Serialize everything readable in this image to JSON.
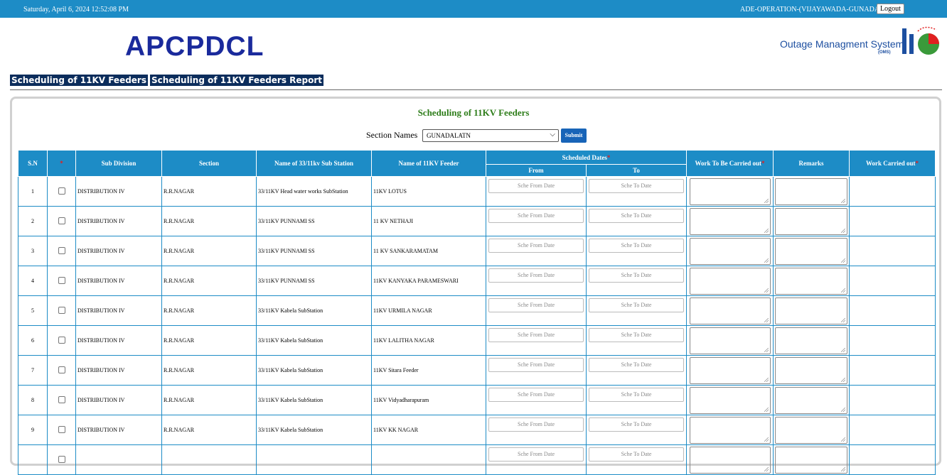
{
  "topbar": {
    "datetime": "Saturday, April 6, 2024 12:52:08 PM",
    "user": "ADE-OPERATION-(VIJAYAWADA-GUNADALA)",
    "logout": "Logout"
  },
  "brand": {
    "name": "APCPDCL",
    "oms_text": "Outage Managment System",
    "oms_sub": "(OMS)"
  },
  "nav": {
    "link1": "Scheduling of 11KV Feeders",
    "link2": "Scheduling of 11KV Feeders Report"
  },
  "page": {
    "title": "Scheduling of 11KV Feeders",
    "section_label": "Section Names",
    "section_value": "GUNADALATN",
    "submit": "Submit"
  },
  "colors": {
    "accent": "#1d8cc6",
    "brand": "#1a2a9c",
    "nav_bg": "#0c2d5c",
    "title_green": "#2e7d1a",
    "required": "#e02020"
  },
  "table": {
    "headers": {
      "sn": "S.N",
      "req": "*",
      "subdiv": "Sub Division",
      "section": "Section",
      "substation": "Name of 33/11kv Sub Station",
      "feeder": "Name of 11KV Feeder",
      "dates": "Scheduled Dates",
      "from": "From",
      "to": "To",
      "work": "Work To Be Carried out",
      "remarks": "Remarks",
      "carried": "Work Carried out"
    },
    "from_placeholder": "Sche From Date",
    "to_placeholder": "Sche To Date",
    "rows": [
      {
        "sn": "1",
        "subdiv": "DISTRIBUTION IV",
        "section": "R.R.NAGAR",
        "substation": "33/11KV Head water works SubStation",
        "feeder": "11KV LOTUS"
      },
      {
        "sn": "2",
        "subdiv": "DISTRIBUTION IV",
        "section": "R.R.NAGAR",
        "substation": "33/11KV PUNNAMI SS",
        "feeder": "11 KV NETHAJI"
      },
      {
        "sn": "3",
        "subdiv": "DISTRIBUTION IV",
        "section": "R.R.NAGAR",
        "substation": "33/11KV PUNNAMI SS",
        "feeder": "11 KV SANKARAMATAM"
      },
      {
        "sn": "4",
        "subdiv": "DISTRIBUTION IV",
        "section": "R.R.NAGAR",
        "substation": "33/11KV PUNNAMI SS",
        "feeder": "11KV KANYAKA PARAMESWARI"
      },
      {
        "sn": "5",
        "subdiv": "DISTRIBUTION IV",
        "section": "R.R.NAGAR",
        "substation": "33/11KV Kabela SubStation",
        "feeder": "11KV URMILA NAGAR"
      },
      {
        "sn": "6",
        "subdiv": "DISTRIBUTION IV",
        "section": "R.R.NAGAR",
        "substation": "33/11KV Kabela SubStation",
        "feeder": "11KV LALITHA NAGAR"
      },
      {
        "sn": "7",
        "subdiv": "DISTRIBUTION IV",
        "section": "R.R.NAGAR",
        "substation": "33/11KV Kabela SubStation",
        "feeder": "11KV Sitara Feeder"
      },
      {
        "sn": "8",
        "subdiv": "DISTRIBUTION IV",
        "section": "R.R.NAGAR",
        "substation": "33/11KV Kabela SubStation",
        "feeder": "11KV Vidyadharapuram"
      },
      {
        "sn": "9",
        "subdiv": "DISTRIBUTION IV",
        "section": "R.R.NAGAR",
        "substation": "33/11KV Kabela SubStation",
        "feeder": "11KV KK NAGAR"
      },
      {
        "sn": "",
        "subdiv": "",
        "section": "",
        "substation": "",
        "feeder": ""
      }
    ]
  }
}
